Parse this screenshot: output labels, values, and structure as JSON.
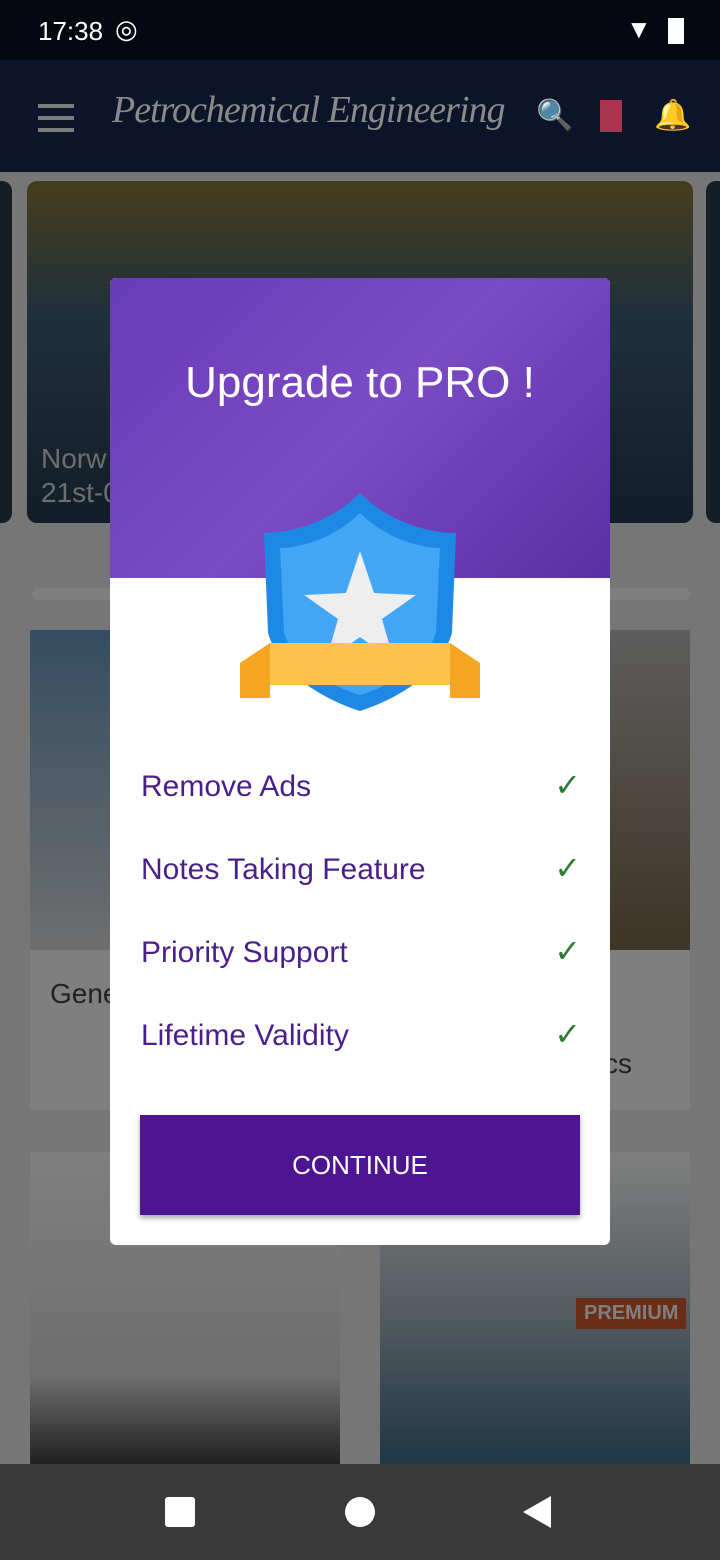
{
  "status": {
    "time": "17:38"
  },
  "appbar": {
    "title": "Petrochemical Engineering"
  },
  "background": {
    "slide_title": "Norw",
    "slide_date": "21st-0",
    "card1": "Gene",
    "card2": "cs",
    "premium": "PREMIUM"
  },
  "dialog": {
    "title": "Upgrade to PRO !",
    "features": [
      "Remove Ads",
      "Notes Taking Feature",
      "Priority Support",
      "Lifetime Validity"
    ],
    "continue": "CONTINUE"
  },
  "colors": {
    "accent": "#4e1593",
    "check": "#2e7d32"
  }
}
